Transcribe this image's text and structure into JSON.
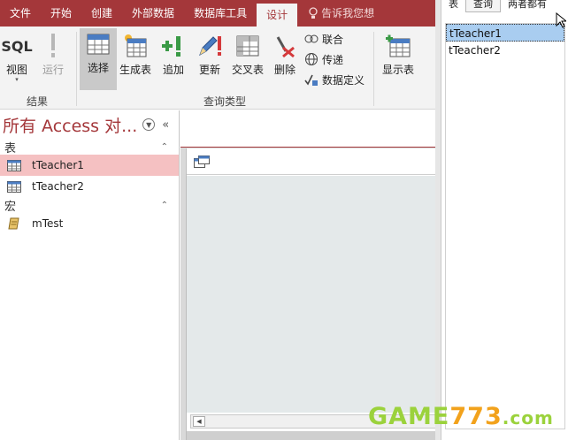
{
  "ribbon_tabs": [
    "文件",
    "开始",
    "创建",
    "外部数据",
    "数据库工具",
    "设计"
  ],
  "active_tab": "设计",
  "tell_me": "告诉我您想",
  "ribbon": {
    "results_group": {
      "label": "结果",
      "view": {
        "icon": "sql-icon",
        "icon_text": "SQL",
        "label": "视图"
      },
      "run": {
        "label": "运行",
        "enabled": false
      }
    },
    "query_type_group": {
      "label": "查询类型",
      "select": {
        "label": "选择",
        "selected": true
      },
      "make_table": {
        "label": "生成表"
      },
      "append": {
        "label": "追加"
      },
      "update": {
        "label": "更新"
      },
      "crosstab": {
        "label": "交叉表"
      },
      "delete": {
        "label": "删除"
      },
      "union": {
        "label": "联合"
      },
      "pass_through": {
        "label": "传递"
      },
      "data_definition": {
        "label": "数据定义"
      }
    },
    "show_table": {
      "label": "显示表"
    }
  },
  "nav_pane": {
    "title": "所有 Access 对...",
    "sections": [
      {
        "label": "表",
        "items": [
          {
            "label": "tTeacher1",
            "selected": true
          },
          {
            "label": "tTeacher2",
            "selected": false
          }
        ]
      },
      {
        "label": "宏",
        "items": [
          {
            "label": "mTest",
            "selected": false
          }
        ]
      }
    ]
  },
  "show_table_dialog": {
    "tabs": [
      "表",
      "查询",
      "两者都有"
    ],
    "items": [
      {
        "label": "tTeacher1",
        "selected": true
      },
      {
        "label": "tTeacher2",
        "selected": false
      }
    ]
  },
  "watermark": {
    "part1": "GAME",
    "part2": "773",
    "part3": ".com"
  },
  "colors": {
    "accent": "#a4373a",
    "nav_selected": "#f5c1c2",
    "list_selected": "#a9cdf0"
  }
}
